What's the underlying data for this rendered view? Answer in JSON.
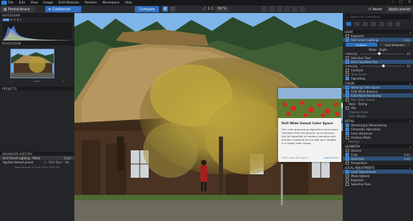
{
  "menubar": {
    "items": [
      "File",
      "Edit",
      "View",
      "Image",
      "DxO Modules",
      "Palettes",
      "Workspace",
      "Help"
    ]
  },
  "toolbar": {
    "tab_library": "PhotoLibrary",
    "tab_customize": "Customize",
    "compare": "Compare",
    "zoom_value": "36 %",
    "zoom_fit": "1:1",
    "reset": "Reset",
    "apply_preset": "Apply preset"
  },
  "left": {
    "histogram_title": "HISTOGRAM",
    "histogram_channels": [
      "RGB",
      "R",
      "G",
      "B",
      "L"
    ],
    "move_zoom_title": "MOVE/ZOOM",
    "exposure_title": "PROJECTS",
    "advanced_history_title": "ADVANCED HISTORY",
    "history": [
      {
        "label": "DxO Smart Lighting - Mode",
        "value": "Slight"
      },
      {
        "label": "Applied default preset",
        "value": "1 - DxO Style - Na..."
      }
    ],
    "history_date": "Imported on 15 Aug 2021 4:05 PM"
  },
  "right": {
    "search_placeholder": "Search for corrections...",
    "sections": {
      "light": "LIGHT",
      "color": "COLOR",
      "detail": "DETAIL",
      "geometry": "GEOMETRY",
      "local": "LOCAL ADJUSTMENTS"
    },
    "light_rows": {
      "exposure": "Exposure",
      "smart_lighting": "DxO Smart Lighting",
      "smart_lighting_value": "Auto",
      "uniform": "Uniform",
      "spot_weighted": "Spot Weighted",
      "mode": "Mode : Slight",
      "intensity": "Intensity",
      "intensity_value": "25",
      "selective_tone": "Selective Tone",
      "clearview": "DxO ClearView Plus",
      "intensity2_value": "50",
      "contrast": "Contrast",
      "tone_curve": "Tone Curve",
      "vignetting": "Vignetting"
    },
    "color_rows": {
      "working_space": "Working Color Space",
      "white_balance": "RGB White Balance",
      "color_rendering": "Color/Style Rendering",
      "wide_gamut": "DxO Wide Gamut",
      "style_toning": "Style - Toning",
      "hsl": "HSL",
      "channel_mixer": "Channel mixer",
      "color_wheels": "Color Wheels"
    },
    "detail_rows": {
      "denoising": "Denoising & Demosaicing",
      "chromatic": "Chromatic Aberration",
      "lens_sharpness": "Lens sharpness",
      "unsharp_mask": "Unsharp Mask",
      "red_eye": "Red Eye"
    },
    "geometry_rows": {
      "horizon": "Horizon",
      "crop": "Crop",
      "crop_value": "Auto",
      "distortion": "Distortion",
      "distortion_value": "Auto",
      "perspective": "Perspective"
    },
    "local_rows": {
      "local_adjustments": "Local Adjustments",
      "mask_options": "Mask Options",
      "exposure": "Exposure",
      "selective_tone": "Selective Tone"
    }
  },
  "tooltip": {
    "title": "DxO Wide Gamut Color Space",
    "body": "Our color processing algorithms have been rewritten from the ground up to harness the full potential of modern monitors and printers, allowing you to edit your images in a larger color space.",
    "dont_show": "Don't show this again",
    "learn_more": "Learn more"
  },
  "colors": {
    "accent": "#2f6fbd",
    "panel": "#242528",
    "header": "#1a1b1d"
  }
}
